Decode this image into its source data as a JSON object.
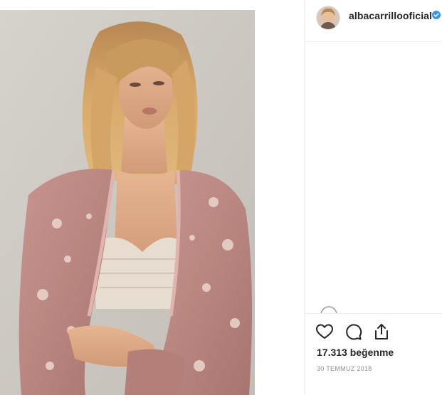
{
  "post": {
    "username": "albacarrillooficial",
    "verified": true,
    "likes_text": "17.313 beğenme",
    "date_text": "30 TEMMUZ 2018"
  },
  "icons": {
    "verified": "verified-badge-icon",
    "like": "heart-icon",
    "comment": "comment-bubble-icon",
    "share": "share-icon"
  },
  "colors": {
    "text_primary": "#262626",
    "text_secondary": "#8e8e8e",
    "verified_blue": "#3897f0",
    "divider": "#efefef"
  }
}
